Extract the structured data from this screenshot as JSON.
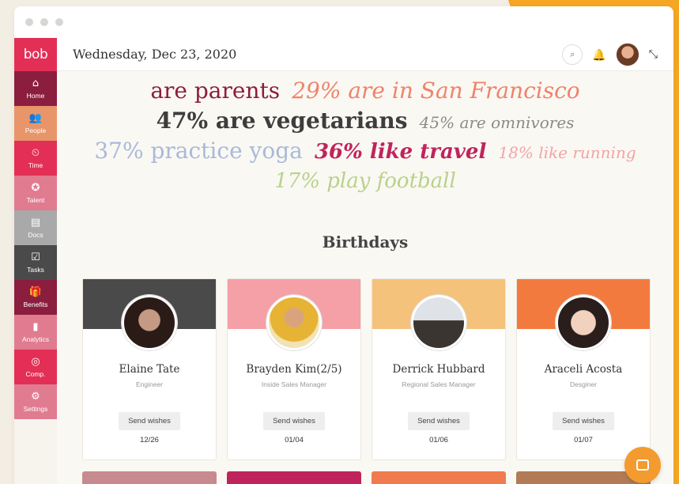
{
  "app": {
    "logo": "bob",
    "date": "Wednesday, Dec 23, 2020"
  },
  "colors": {
    "brand": "#e32f55",
    "accent_orange": "#f5a623"
  },
  "sidebar": {
    "items": [
      {
        "label": "Home",
        "icon": "home-icon",
        "glyph": "⌂",
        "color": "#8b1e3f"
      },
      {
        "label": "People",
        "icon": "people-icon",
        "glyph": "👥",
        "color": "#e8956a"
      },
      {
        "label": "Time",
        "icon": "clock-icon",
        "glyph": "⏲",
        "color": "#e32f55"
      },
      {
        "label": "Talent",
        "icon": "badge-icon",
        "glyph": "✪",
        "color": "#e07b90"
      },
      {
        "label": "Docs",
        "icon": "docs-icon",
        "glyph": "▤",
        "color": "#a9a9a9"
      },
      {
        "label": "Tasks",
        "icon": "checkbox-icon",
        "glyph": "☑",
        "color": "#4a4a4a"
      },
      {
        "label": "Benefits",
        "icon": "gift-icon",
        "glyph": "🎁",
        "color": "#8b1e3f"
      },
      {
        "label": "Analytics",
        "icon": "bar-chart-icon",
        "glyph": "▮",
        "color": "#e07b90"
      },
      {
        "label": "Comp.",
        "icon": "coins-icon",
        "glyph": "◎",
        "color": "#e32f55"
      },
      {
        "label": "Settings",
        "icon": "gear-icon",
        "glyph": "⚙",
        "color": "#e07b90"
      }
    ]
  },
  "header_icons": {
    "search": {
      "icon": "search-icon",
      "glyph": "⌕"
    },
    "bell": {
      "icon": "bell-icon",
      "glyph": "🔔"
    },
    "collapse": {
      "icon": "collapse-icon",
      "glyph": "⤡"
    }
  },
  "word_cloud": [
    {
      "text": "are parents",
      "color": "#8b1e3f",
      "size": 28,
      "italic": false,
      "bold": false
    },
    {
      "text": "29% are in San Francisco",
      "color": "#f0826a",
      "size": 28,
      "italic": true,
      "bold": false
    },
    {
      "text": "47% are vegetarians",
      "color": "#3d3d3d",
      "size": 28,
      "italic": false,
      "bold": true
    },
    {
      "text": "45% are omnivores",
      "color": "#8a8a8a",
      "size": 20,
      "italic": true,
      "bold": false
    },
    {
      "text": "37% practice yoga",
      "color": "#a9b9d9",
      "size": 28,
      "italic": false,
      "bold": false
    },
    {
      "text": "36% like travel",
      "color": "#c0245d",
      "size": 26,
      "italic": true,
      "bold": true
    },
    {
      "text": "18% like running",
      "color": "#f4a3a8",
      "size": 20,
      "italic": true,
      "bold": false
    },
    {
      "text": "17% play football",
      "color": "#b7d28a",
      "size": 26,
      "italic": true,
      "bold": false
    }
  ],
  "birthdays": {
    "title": "Birthdays",
    "send_label": "Send wishes",
    "cards": [
      {
        "name": "Elaine Tate",
        "role": "Engineer",
        "date": "12/26",
        "banner": "#4a4a4a",
        "photo_bg": "radial-gradient(circle at 50% 45%, #c49a84 0 28%, #2b1b16 30% 100%)"
      },
      {
        "name": "Brayden Kim(2/5)",
        "role": "Inside Sales Manager",
        "date": "01/04",
        "banner": "#f4a0a6",
        "photo_bg": "radial-gradient(circle at 50% 40%, #d9a47d 0 24%, #e7b334 26% 60%, #f2e3b5 62% 100%)"
      },
      {
        "name": "Derrick Hubbard",
        "role": "Regional Sales Manager",
        "date": "01/06",
        "banner": "#f5c27c",
        "photo_bg": "linear-gradient(180deg, #dfe3e7 0 45%, #3a3530 46% 100%)"
      },
      {
        "name": "Araceli Acosta",
        "role": "Desginer",
        "date": "01/07",
        "banner": "#f37a3e",
        "photo_bg": "radial-gradient(circle at 50% 50%, #f1d2bf 0 34%, #2a1e1c 36% 100%)"
      }
    ],
    "peek_colors": [
      "#c78a8f",
      "#c0245d",
      "#f07b4f",
      "#b27b55"
    ]
  },
  "chat": {
    "icon": "chat-icon"
  }
}
